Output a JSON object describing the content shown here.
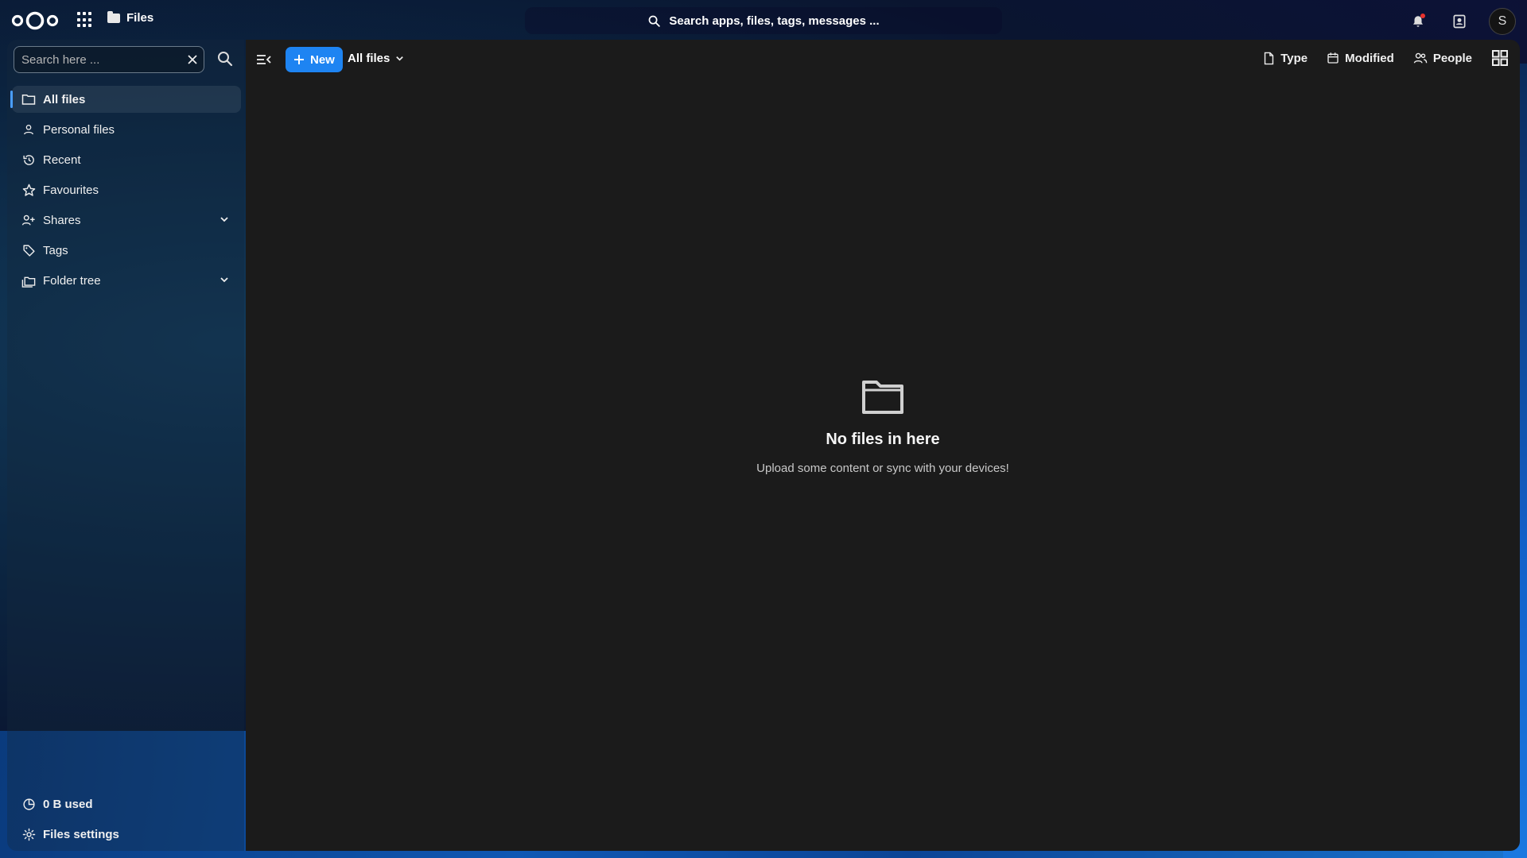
{
  "header": {
    "app_name": "Files",
    "search_label": "Search apps, files, tags, messages ...",
    "avatar_initial": "S",
    "icons": [
      "nextcloud-logo",
      "apps-grid-icon",
      "folder-icon",
      "search-icon",
      "bell-icon",
      "contacts-icon"
    ]
  },
  "sidebar": {
    "search_placeholder": "Search here ...",
    "items": [
      {
        "label": "All files",
        "icon": "folder-icon",
        "active": true
      },
      {
        "label": "Personal files",
        "icon": "person-icon"
      },
      {
        "label": "Recent",
        "icon": "history-icon"
      },
      {
        "label": "Favourites",
        "icon": "star-icon"
      },
      {
        "label": "Shares",
        "icon": "share-icon",
        "expandable": true
      },
      {
        "label": "Tags",
        "icon": "tag-icon"
      },
      {
        "label": "Folder tree",
        "icon": "folder-tree-icon",
        "expandable": true
      }
    ],
    "quota": "0 B used",
    "settings": "Files settings"
  },
  "toolbar": {
    "new_label": "New",
    "breadcrumb": "All files",
    "filters": {
      "type": "Type",
      "modified": "Modified",
      "people": "People"
    }
  },
  "empty_state": {
    "title": "No files in here",
    "subtitle": "Upload some content or sync with your devices!"
  },
  "colors": {
    "accent": "#1e84f2",
    "main_bg": "#1b1b1b",
    "notification_dot": "#e9322d"
  }
}
